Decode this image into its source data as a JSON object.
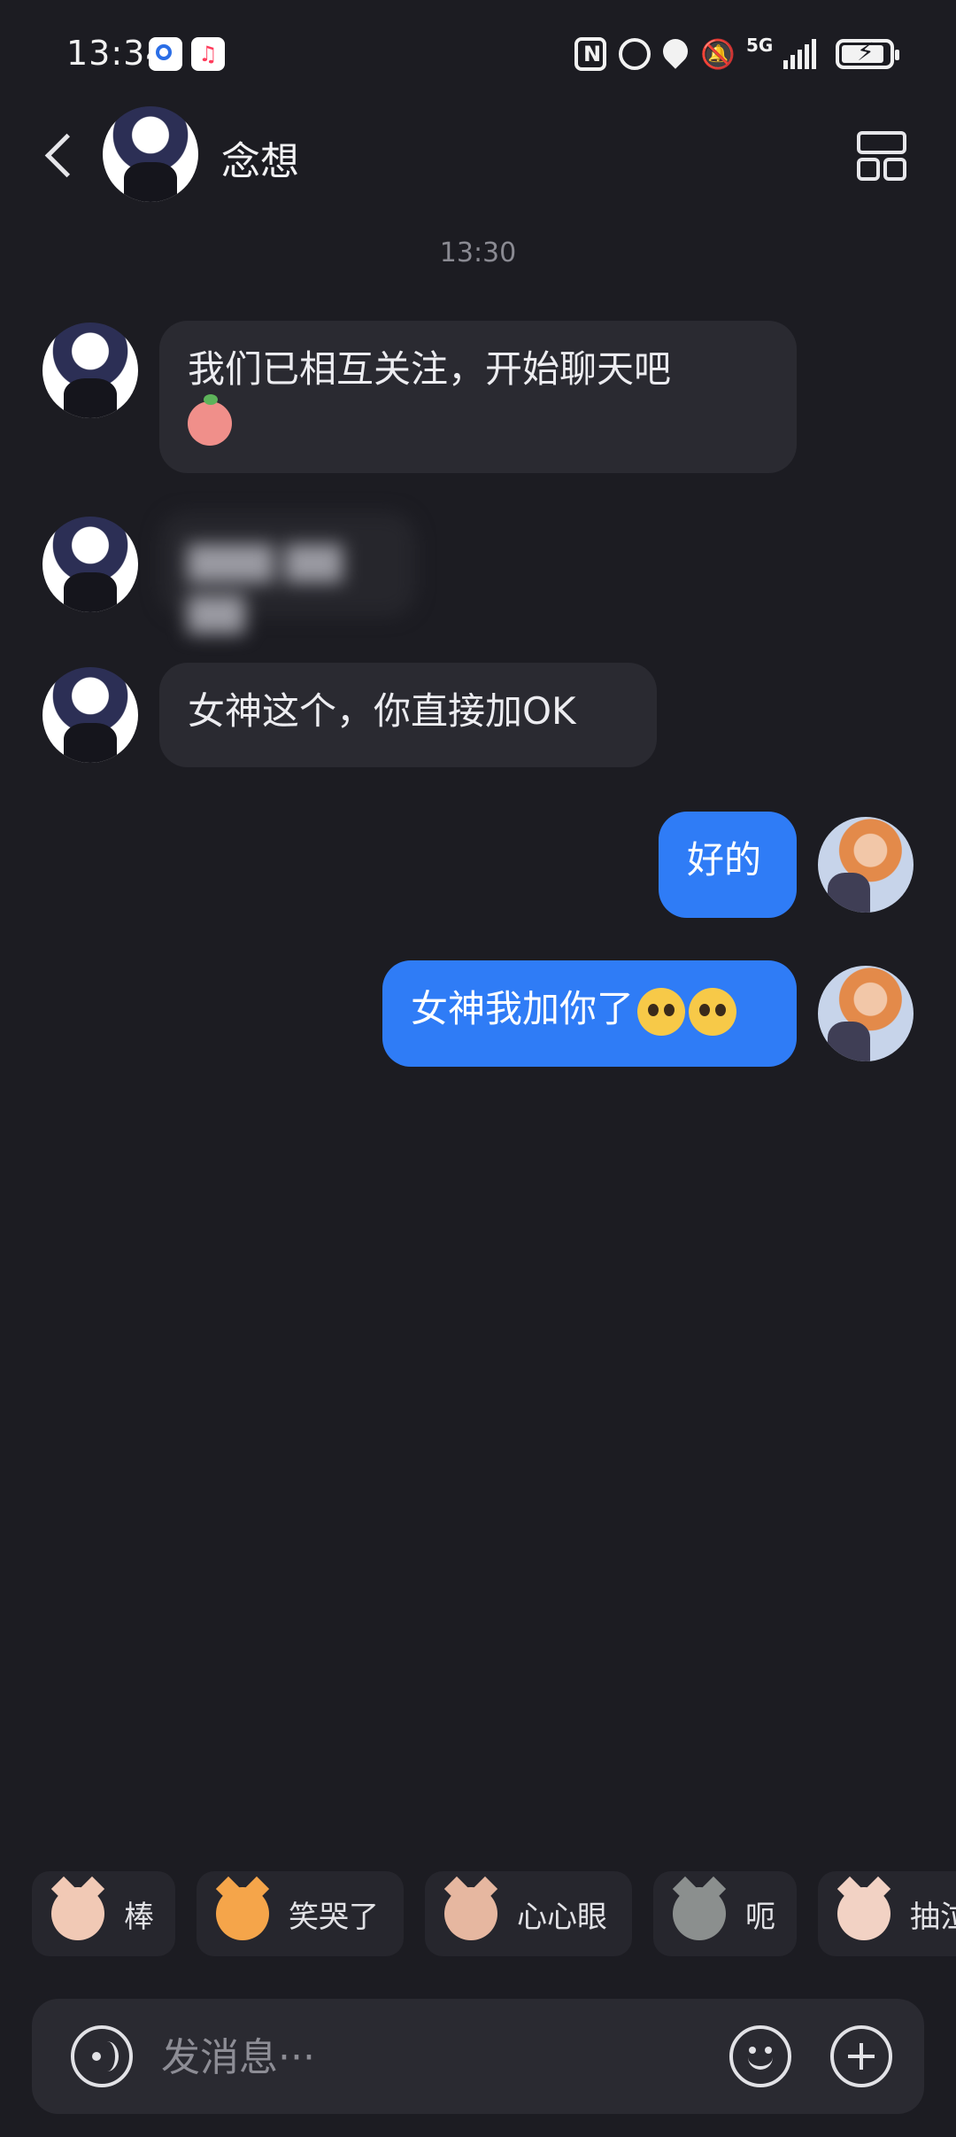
{
  "status_bar": {
    "time": "13:34",
    "network": "5G",
    "battery_level": 0.9,
    "icons": [
      "app-badge-1",
      "music-app-icon",
      "nfc-icon",
      "alarm-icon",
      "location-icon",
      "mute-icon",
      "5g-icon",
      "signal-icon",
      "battery-charging-icon"
    ]
  },
  "header": {
    "contact_name": "念想",
    "back_icon": "chevron-left-icon",
    "menu_icon": "grid-layout-icon"
  },
  "conversation": {
    "timestamp": "13:30",
    "messages": [
      {
        "from": "other",
        "text": "我们已相互关注，开始聊天吧",
        "emoji": "peach-emoji"
      },
      {
        "from": "other",
        "text": "▇▇▇ ▇▇ ▇▇",
        "blurred": true
      },
      {
        "from": "other",
        "text": "女神这个，你直接加OK"
      },
      {
        "from": "me",
        "text": "好的"
      },
      {
        "from": "me",
        "text": "女神我加你了",
        "emoji": "pleading-face-emoji x2"
      }
    ]
  },
  "stickers": [
    {
      "label": "棒",
      "color": "#f1c9b5"
    },
    {
      "label": "笑哭了",
      "color": "#f5a54a"
    },
    {
      "label": "心心眼",
      "color": "#e6b7a0"
    },
    {
      "label": "呃",
      "color": "#8b8f8e"
    },
    {
      "label": "抽泣",
      "color": "#f2d2c4"
    }
  ],
  "input": {
    "placeholder": "发消息···",
    "voice_icon": "voice-icon",
    "emoji_icon": "emoji-icon",
    "plus_icon": "plus-icon"
  },
  "colors": {
    "background": "#1c1c22",
    "incoming_bubble": "#2a2a31",
    "outgoing_bubble": "#2f7cf6"
  }
}
